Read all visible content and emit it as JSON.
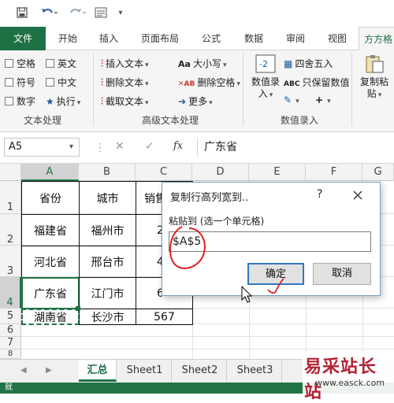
{
  "quick_access": {
    "save_icon": "save-icon",
    "undo_icon": "undo-icon",
    "redo_icon": "redo-icon",
    "form_icon": "form-icon",
    "customize_icon": "chevron-down-icon"
  },
  "tabs": [
    "文件",
    "开始",
    "插入",
    "页面布局",
    "公式",
    "数据",
    "审阅",
    "视图",
    "方方格"
  ],
  "ribbon": {
    "text_processing": {
      "items": [
        "空格",
        "英文",
        "符号",
        "中文",
        "数字",
        "执行"
      ],
      "group_label": "文本处理"
    },
    "advanced_text": {
      "insert_text": "插入文本",
      "delete_text": "删除文本",
      "extract_text": "截取文本",
      "case": "大小写",
      "delete_space": "删除空格",
      "more": "更多",
      "group_label": "高级文本处理"
    },
    "number_entry": {
      "numeric_line1": "数值录",
      "numeric_line2": "入",
      "round": "四舍五入",
      "keep_values": "只保留数值",
      "group_label": "数值录入"
    },
    "copy_paste": {
      "line1": "复制粘",
      "line2": "贴"
    }
  },
  "formula_bar": {
    "name_box": "A5",
    "cancel_symbol": "✕",
    "confirm_symbol": "✓",
    "fx_symbol": "fx",
    "formula": "广东省"
  },
  "columns": [
    "A",
    "B",
    "C",
    "D",
    "E",
    "F",
    "G"
  ],
  "rows": [
    "1",
    "2",
    "3",
    "4",
    "5",
    "6",
    "7",
    "8"
  ],
  "table": {
    "headers": [
      "省份",
      "城市",
      "销售"
    ],
    "rows": [
      [
        "福建省",
        "福州市",
        "2"
      ],
      [
        "河北省",
        "邢台市",
        "4"
      ],
      [
        "广东省",
        "江门市",
        "6"
      ],
      [
        "湖南省",
        "长沙市",
        "567"
      ]
    ]
  },
  "sheet_tabs": [
    "汇总",
    "Sheet1",
    "Sheet2",
    "Sheet3"
  ],
  "sheet_nav": {
    "prev": "◀",
    "next": "▶"
  },
  "status": {
    "ready": "就"
  },
  "dialog": {
    "title": "复制行高列宽到..",
    "help": "?",
    "close_icon": "close-icon",
    "prompt": "粘贴到 (选一个单元格)",
    "input_value": "$A$5",
    "ok": "确定",
    "cancel": "取消"
  },
  "watermark": {
    "text": "易采站长站",
    "url": "www.easck.com"
  },
  "colors": {
    "excel_green": "#217346",
    "file_tab": "#1e7145",
    "annotation_red": "#e02020",
    "dialog_button_border": "#2f77c4"
  }
}
